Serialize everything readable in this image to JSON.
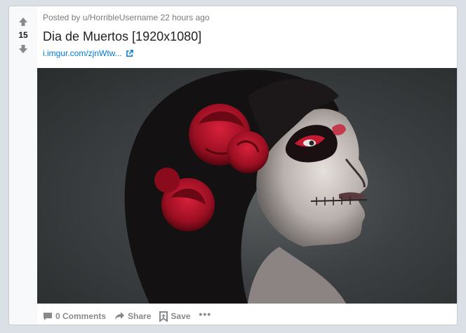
{
  "post": {
    "score": "15",
    "meta_prefix": "Posted by",
    "author": "u/HorribleUsername",
    "time": "22 hours ago",
    "title": "Dia de Muertos [1920x1080]",
    "link_text": "i.imgur.com/zjnWtw...",
    "image_alt": "Dia de Muertos"
  },
  "actions": {
    "comments_label": "0 Comments",
    "share_label": "Share",
    "save_label": "Save",
    "more_label": "•••"
  },
  "icons": {
    "upvote": "upvote-arrow-icon",
    "downvote": "downvote-arrow-icon",
    "external_link": "external-link-icon",
    "comment": "comment-icon",
    "share": "share-icon",
    "save": "save-icon"
  },
  "colors": {
    "background": "#dae0e6",
    "card": "#ffffff",
    "vote_column": "#f8f9fa",
    "link": "#0079d3",
    "meta_text": "#787c7e",
    "action_text": "#878a8c",
    "title_text": "#222222",
    "flower": "#b3122a"
  }
}
